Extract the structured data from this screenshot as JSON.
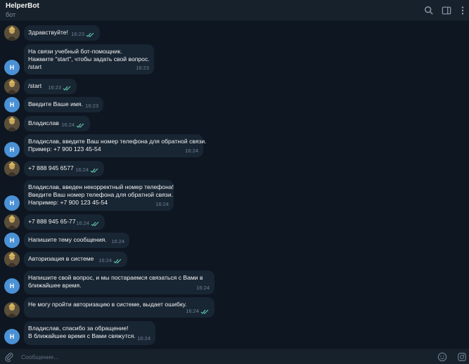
{
  "header": {
    "title": "HelperBot",
    "subtitle": "бот",
    "icons": [
      "search-icon",
      "sidebar-toggle-icon",
      "more-vert-icon"
    ]
  },
  "bot_avatar_letter": "H",
  "messages": [
    {
      "from": "user",
      "lines": [
        "Здравствуйте!"
      ],
      "time": "16:23",
      "read": true
    },
    {
      "from": "bot",
      "lines": [
        "На связи учебный бот-помощник.",
        "Нажмите \"start\", чтобы задать свой вопрос."
      ],
      "link": "/start",
      "time": "16:23"
    },
    {
      "from": "user",
      "lines": [
        "/start"
      ],
      "time": "16:23",
      "read": true
    },
    {
      "from": "bot",
      "lines": [
        "Введите Ваше имя."
      ],
      "time": "16:23"
    },
    {
      "from": "user",
      "lines": [
        "Владислав"
      ],
      "time": "16:24",
      "read": true
    },
    {
      "from": "bot",
      "lines": [
        "Владислав, введите Ваш номер телефона для обратной связи.",
        "Пример: +7 900 123 45-54"
      ],
      "time": "16:24"
    },
    {
      "from": "user",
      "lines": [
        "+7 888 945 6577"
      ],
      "time": "16:24",
      "read": true
    },
    {
      "from": "bot",
      "lines": [
        "Владислав, введен некорректный номер телефона!",
        "Введите Ваш номер телефона для обратной связи.",
        "Например: +7 900 123 45-54"
      ],
      "time": "16:24"
    },
    {
      "from": "user",
      "lines": [
        "+7 888 945 65-77"
      ],
      "time": "16:24",
      "read": true
    },
    {
      "from": "bot",
      "lines": [
        "Напишите тему сообщения."
      ],
      "time": "16:24"
    },
    {
      "from": "user",
      "lines": [
        "Авторизация в системе"
      ],
      "time": "16:24",
      "read": true
    },
    {
      "from": "bot",
      "lines": [
        "Напишите свой вопрос, и мы постараемся связаться с Вами в",
        "ближайшее время."
      ],
      "time": "16:24"
    },
    {
      "from": "user",
      "lines": [
        "Не могу пройти авторизацию в системе, выдает ошибку."
      ],
      "time": "16:24",
      "read": true
    },
    {
      "from": "bot",
      "lines": [
        "Владислав, спасибо за обращение!",
        "В ближайшее время с Вами свяжутся."
      ],
      "time": "16:24"
    }
  ],
  "composer": {
    "placeholder": "Сообщение...",
    "icons": [
      "attach-icon",
      "emoji-icon",
      "sticker-icon"
    ]
  },
  "colors": {
    "background": "#0e1621",
    "header": "#17212b",
    "bubble": "#182533",
    "bot_avatar": "#4a91d6",
    "read_check": "#5fc4a8",
    "link": "#62bcf9"
  }
}
